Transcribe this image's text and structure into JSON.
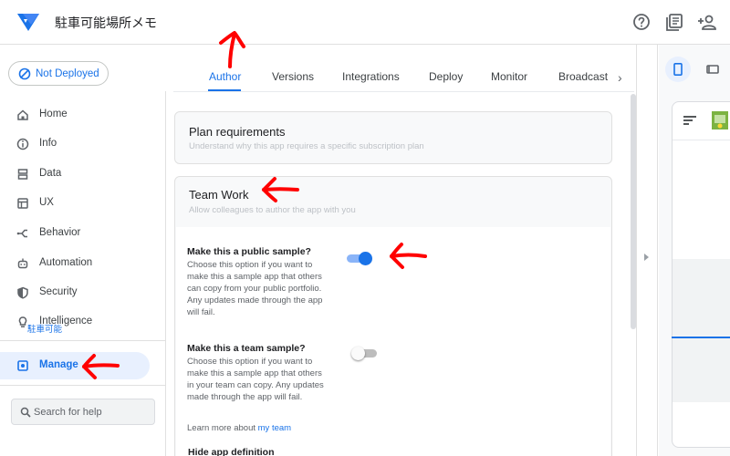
{
  "header": {
    "app_title": "駐車可能場所メモ",
    "icons": [
      "help-icon",
      "docs-icon",
      "share-person-icon"
    ]
  },
  "deploy": {
    "label": "Not Deployed"
  },
  "tabs": [
    {
      "label": "Author",
      "active": true
    },
    {
      "label": "Versions"
    },
    {
      "label": "Integrations"
    },
    {
      "label": "Deploy"
    },
    {
      "label": "Monitor"
    },
    {
      "label": "Broadcast"
    }
  ],
  "sidebar": {
    "items": [
      {
        "label": "Home",
        "icon": "home-icon"
      },
      {
        "label": "Info",
        "icon": "info-icon"
      },
      {
        "label": "Data",
        "icon": "data-icon"
      },
      {
        "label": "UX",
        "icon": "ux-icon"
      },
      {
        "label": "Behavior",
        "icon": "behavior-icon"
      },
      {
        "label": "Automation",
        "icon": "automation-icon"
      },
      {
        "label": "Security",
        "icon": "security-icon"
      },
      {
        "label": "Intelligence",
        "icon": "intelligence-icon"
      },
      {
        "label": "Manage",
        "icon": "manage-icon",
        "active": true
      }
    ],
    "search_placeholder": "Search for help"
  },
  "main": {
    "plan": {
      "title": "Plan requirements",
      "subtitle": "Understand why this app requires a specific subscription plan"
    },
    "team": {
      "title": "Team Work",
      "subtitle": "Allow colleagues to author the app with you",
      "public_sample": {
        "title": "Make this a public sample?",
        "desc_lines": [
          "Choose this option if you want to",
          "make this a sample app that others",
          "can copy from your public portfolio.",
          "Any updates made through the app",
          "will fail."
        ],
        "enabled": true
      },
      "team_sample": {
        "title": "Make this a team sample?",
        "desc_lines": [
          "Choose this option if you want to",
          "make this a sample app that others",
          "in your team can copy. Any updates",
          "made through the app will fail."
        ],
        "enabled": false
      },
      "learn_prefix": "Learn more about",
      "learn_link": "my team",
      "hide_def": "Hide app definition"
    }
  },
  "preview": {
    "tab_label": "駐車可能"
  },
  "colors": {
    "accent": "#1a73e8",
    "active_bg": "#e8f0fe",
    "annotation": "#ff0000"
  }
}
